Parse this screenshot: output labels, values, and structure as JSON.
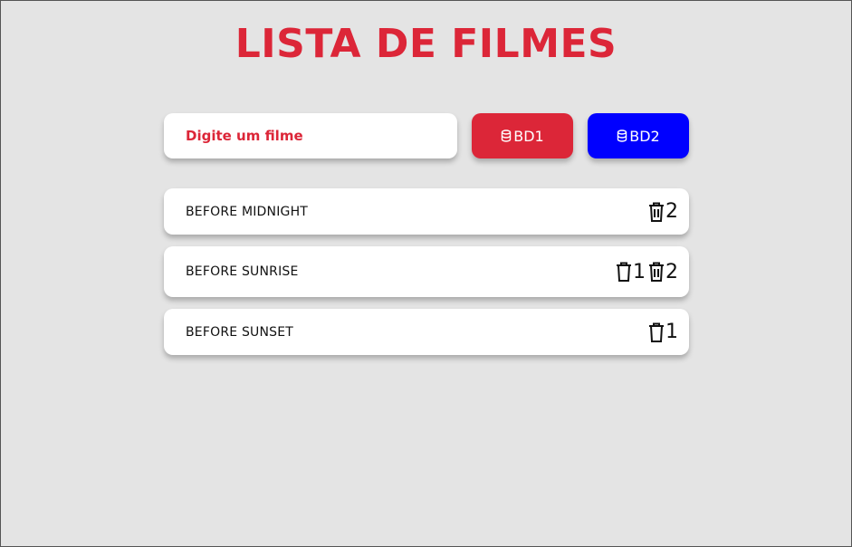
{
  "page": {
    "title": "LISTA DE FILMES"
  },
  "search": {
    "placeholder": "Digite um filme",
    "value": ""
  },
  "buttons": {
    "bd1_label": "BD1",
    "bd2_label": "BD2",
    "bd1_color": "#dc2638",
    "bd2_color": "#0000ff",
    "icon": "database-icon"
  },
  "movies": [
    {
      "name": "BEFORE MIDNIGHT",
      "actions": [
        {
          "icon": "trash-filled-icon",
          "label": "2"
        }
      ]
    },
    {
      "name": "BEFORE SUNRISE",
      "actions": [
        {
          "icon": "trash-outline-icon",
          "label": "1"
        },
        {
          "icon": "trash-filled-icon",
          "label": "2"
        }
      ]
    },
    {
      "name": "BEFORE SUNSET",
      "actions": [
        {
          "icon": "trash-outline-icon",
          "label": "1"
        }
      ]
    }
  ],
  "colors": {
    "accent": "#dc2638",
    "background": "#e4e4e4",
    "card": "#ffffff"
  }
}
